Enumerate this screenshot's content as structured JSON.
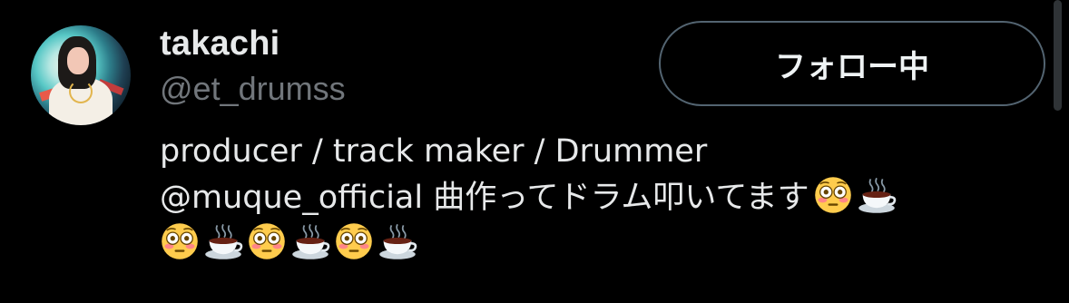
{
  "profile": {
    "display_name": "takachi",
    "handle": "@et_drumss",
    "follow_label": "フォロー中"
  },
  "bio": {
    "line1": "producer / track maker / Drummer",
    "line2_text": "@muque_official 曲作ってドラム叩いてます",
    "emojis": [
      "flushed-face",
      "hot-beverage",
      "flushed-face",
      "hot-beverage",
      "flushed-face",
      "hot-beverage",
      "flushed-face",
      "hot-beverage"
    ]
  },
  "colors": {
    "background": "#000000",
    "text_primary": "#e7e9ea",
    "text_secondary": "#71767b",
    "button_border": "#536471"
  }
}
